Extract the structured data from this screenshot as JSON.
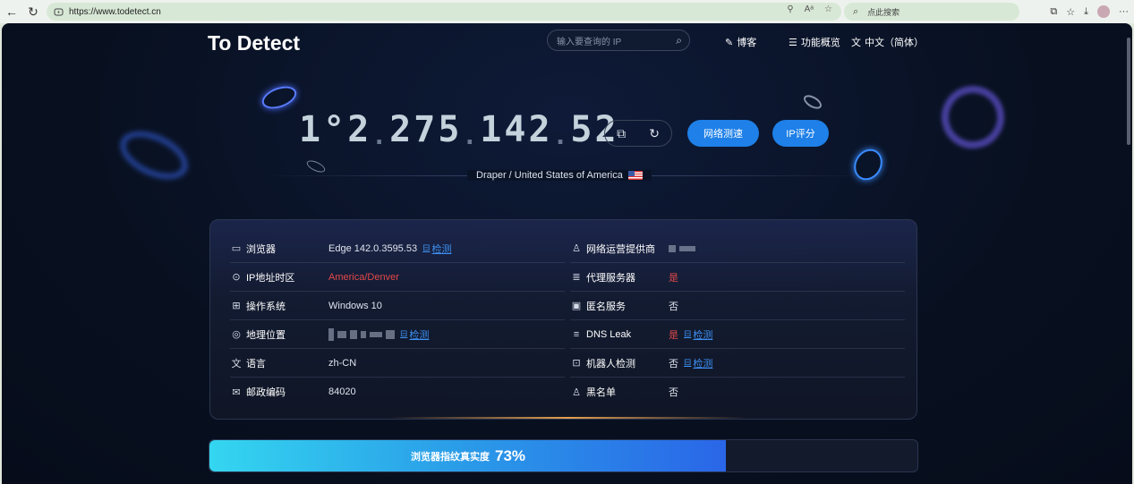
{
  "browser": {
    "url": "https://www.todetect.cn",
    "search_placeholder": "点此搜索"
  },
  "site": {
    "logo": "To Detect",
    "ip_search_placeholder": "输入要查询的 IP",
    "nav": {
      "blog": "博客",
      "features": "功能概览",
      "language": "中文（简体）"
    }
  },
  "ip": {
    "chars": [
      "1",
      "°",
      "2",
      ".",
      "2",
      "7",
      "5",
      ".",
      "1",
      "4",
      "2",
      ".",
      "5",
      "2"
    ],
    "location": "Draper / United States of America",
    "speed_test_label": "网络测速",
    "ip_score_label": "IP评分"
  },
  "info": {
    "left": [
      {
        "label": "浏览器",
        "value": "Edge 142.0.3595.53",
        "check": "检测",
        "red": false
      },
      {
        "label": "IP地址时区",
        "value": "America/Denver",
        "check": "",
        "red": true
      },
      {
        "label": "操作系统",
        "value": "Windows 10",
        "check": "",
        "red": false
      },
      {
        "label": "地理位置",
        "value": "",
        "check": "检测",
        "red": false
      },
      {
        "label": "语言",
        "value": "zh-CN",
        "check": "",
        "red": false
      },
      {
        "label": "邮政编码",
        "value": "84020",
        "check": "",
        "red": false
      }
    ],
    "right": [
      {
        "label": "网络运营提供商",
        "value": "",
        "check": "",
        "red": false
      },
      {
        "label": "代理服务器",
        "value": "是",
        "check": "",
        "red": true
      },
      {
        "label": "匿名服务",
        "value": "否",
        "check": "",
        "red": false
      },
      {
        "label": "DNS Leak",
        "value": "是",
        "check": "检测",
        "red": true
      },
      {
        "label": "机器人检测",
        "value": "否",
        "check": "检测",
        "red": false
      },
      {
        "label": "黑名单",
        "value": "否",
        "check": "",
        "red": false
      }
    ]
  },
  "fingerprint": {
    "label": "浏览器指纹真实度",
    "percent_text": "73%",
    "percent": 73
  },
  "colors": {
    "accent": "#1e80e8",
    "danger": "#e04848",
    "link": "#3d8ff0"
  }
}
